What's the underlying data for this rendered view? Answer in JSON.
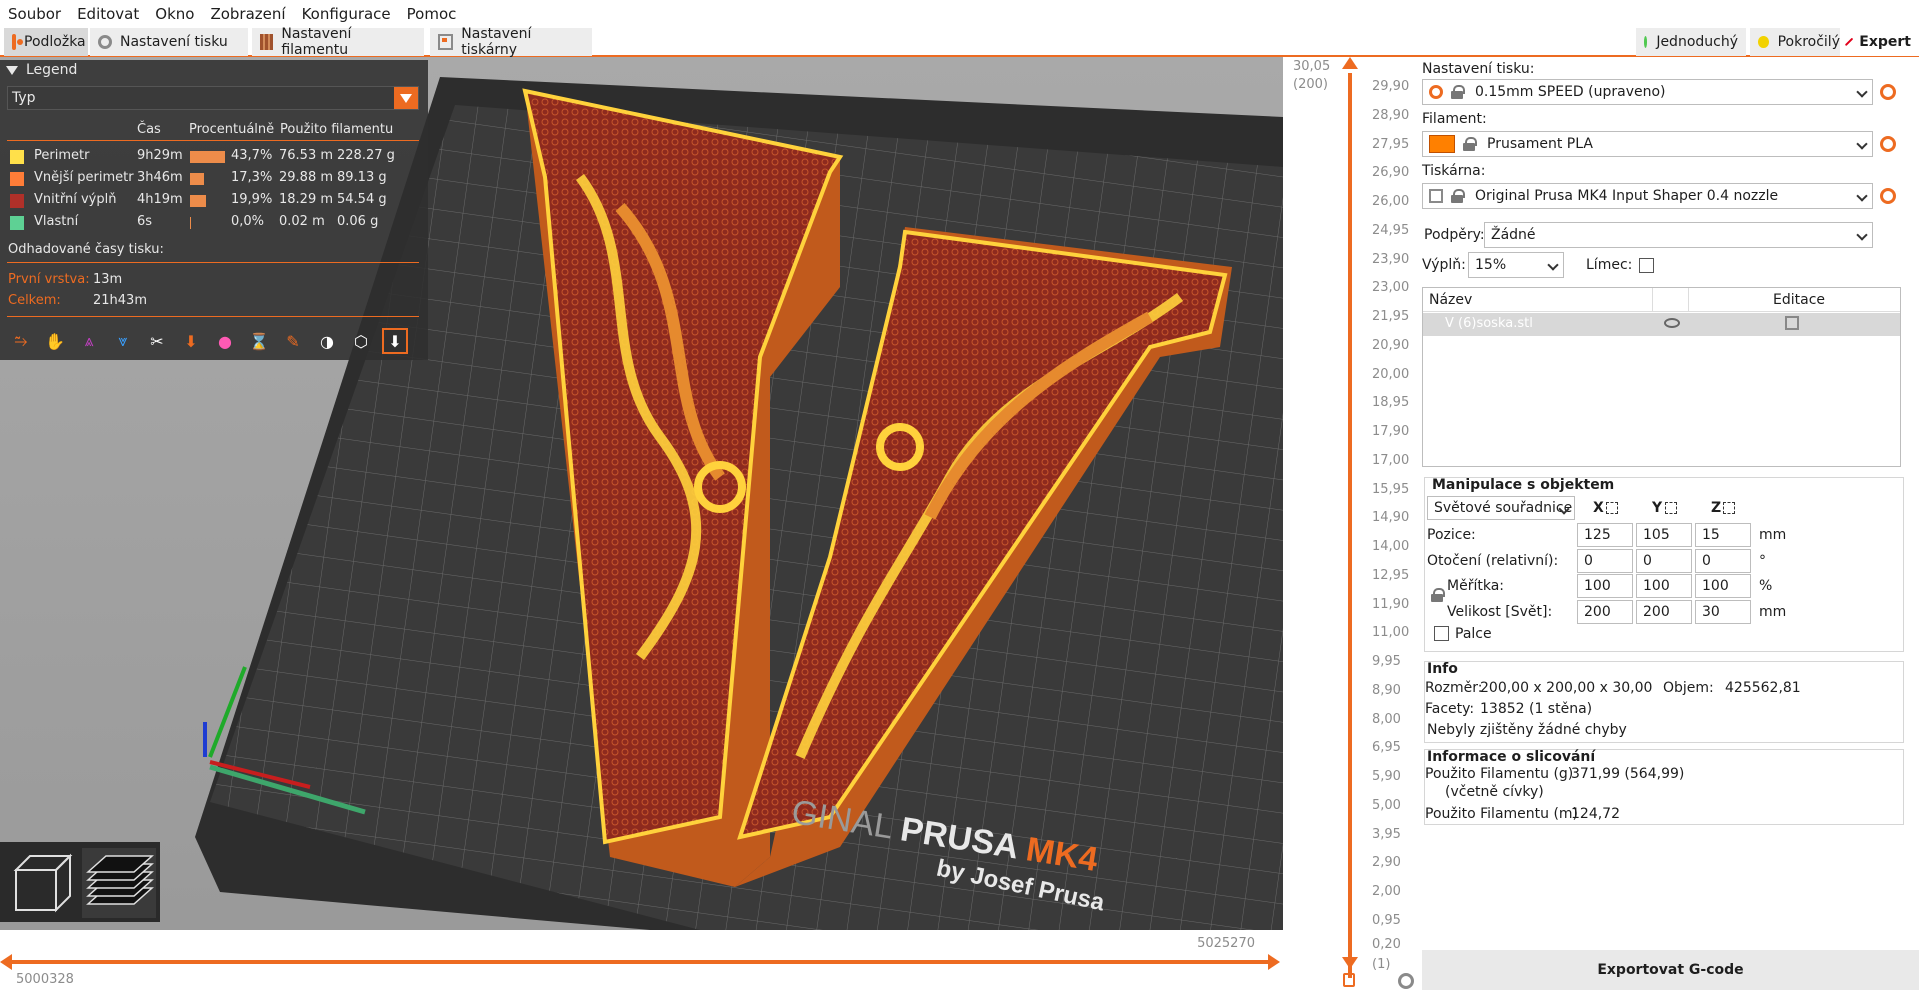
{
  "menu": [
    "Soubor",
    "Editovat",
    "Okno",
    "Zobrazení",
    "Konfigurace",
    "Pomoc"
  ],
  "tabs": [
    {
      "label": "Podložka",
      "icon": "plater-icon"
    },
    {
      "label": "Nastavení tisku",
      "icon": "gear-icon"
    },
    {
      "label": "Nastavení filamentu",
      "icon": "spool-icon"
    },
    {
      "label": "Nastavení tiskárny",
      "icon": "printer-icon"
    }
  ],
  "modes": [
    {
      "label": "Jednoduchý",
      "color": "#4fc84f"
    },
    {
      "label": "Pokročilý",
      "color": "#f2d200"
    },
    {
      "label": "Expert",
      "color": "#e2001a"
    }
  ],
  "legend": {
    "title": "Legend",
    "type_select": "Typ",
    "headers": {
      "time": "Čas",
      "percent": "Procentuálně",
      "used": "Použito filamentu"
    },
    "rows": [
      {
        "name": "Perimetr",
        "time": "9h29m",
        "percent": "43,7%",
        "length": "76.53 m",
        "weight": "228.27 g",
        "color": "#ffe04a",
        "fraction": 0.437
      },
      {
        "name": "Vnější perimetr",
        "time": "3h46m",
        "percent": "17,3%",
        "length": "29.88 m",
        "weight": "89.13 g",
        "color": "#ff7d38",
        "fraction": 0.173
      },
      {
        "name": "Vnitřní výplň",
        "time": "4h19m",
        "percent": "19,9%",
        "length": "18.29 m",
        "weight": "54.54 g",
        "color": "#b03029",
        "fraction": 0.199
      },
      {
        "name": "Vlastní",
        "time": "6s",
        "percent": "0,0%",
        "length": "0.02 m",
        "weight": "0.06 g",
        "color": "#5ed194",
        "fraction": 0.0
      }
    ],
    "estimated_title": "Odhadované časy tisku:",
    "first_layer_label": "První vrstva:",
    "first_layer_value": "13m",
    "total_label": "Celkem:",
    "total_value": "21h43m"
  },
  "bed_text": {
    "brand1": "GINAL ",
    "brand2": "PRUSA ",
    "brand3": "MK4",
    "sub": "by Josef Prusa"
  },
  "hslider": {
    "right_value": "5025270",
    "left_value": "5000328"
  },
  "vslider": {
    "top_label": "30,05",
    "top_sub": "(200)",
    "bottom_label": "0,20",
    "bottom_sub": "(1)",
    "ticks": [
      "29,90",
      "28,90",
      "27,95",
      "26,90",
      "26,00",
      "24,95",
      "23,90",
      "23,00",
      "21,95",
      "20,90",
      "20,00",
      "18,95",
      "17,90",
      "17,00",
      "15,95",
      "14,90",
      "14,00",
      "12,95",
      "11,90",
      "11,00",
      "9,95",
      "8,90",
      "8,00",
      "6,95",
      "5,90",
      "5,00",
      "3,95",
      "2,90",
      "2,00",
      "0,95"
    ]
  },
  "right": {
    "print_label": "Nastavení tisku:",
    "print_value": "0.15mm SPEED (upraveno)",
    "filament_label": "Filament:",
    "filament_value": "Prusament PLA",
    "filament_color": "#ff8000",
    "printer_label": "Tiskárna:",
    "printer_value": "Original Prusa MK4 Input Shaper 0.4 nozzle",
    "supports_label": "Podpěry:",
    "supports_value": "Žádné",
    "infill_label": "Výplň:",
    "infill_value": "15%",
    "brim_label": "Límec:",
    "list_name_header": "Název",
    "list_edit_header": "Editace",
    "object_name": "V (6)soska.stl",
    "manip_title": "Manipulace s objektem",
    "coords_select": "Světové souřadnice",
    "axis_x": "X",
    "axis_y": "Y",
    "axis_z": "Z",
    "position_label": "Pozice:",
    "position": [
      "125",
      "105",
      "15"
    ],
    "position_unit": "mm",
    "rotation_label": "Otočení (relativní):",
    "rotation": [
      "0",
      "0",
      "0"
    ],
    "rotation_unit": "°",
    "scale_label": "Měřítka:",
    "scale": [
      "100",
      "100",
      "100"
    ],
    "scale_unit": "%",
    "size_label": "Velikost [Svět]:",
    "size": [
      "200",
      "200",
      "30"
    ],
    "size_unit": "mm",
    "inches_label": "Palce",
    "info_title": "Info",
    "dim_label": "Rozměr:",
    "dim_value": "200,00 x 200,00 x 30,00",
    "volume_label": "Objem:",
    "volume_value": "425562,81",
    "facets_label": "Facety:",
    "facets_value": "13852 (1 stěna)",
    "errors_text": "Nebyly zjištěny žádné chyby",
    "slice_title": "Informace o slicování",
    "used_g_label": "Použito Filamentu (g)",
    "used_g_sub": "(včetně cívky)",
    "used_g_value": "371,99 (564,99)",
    "used_m_label": "Použito Filamentu (m)",
    "used_m_value": "124,72",
    "export_label": "Exportovat G-code"
  }
}
